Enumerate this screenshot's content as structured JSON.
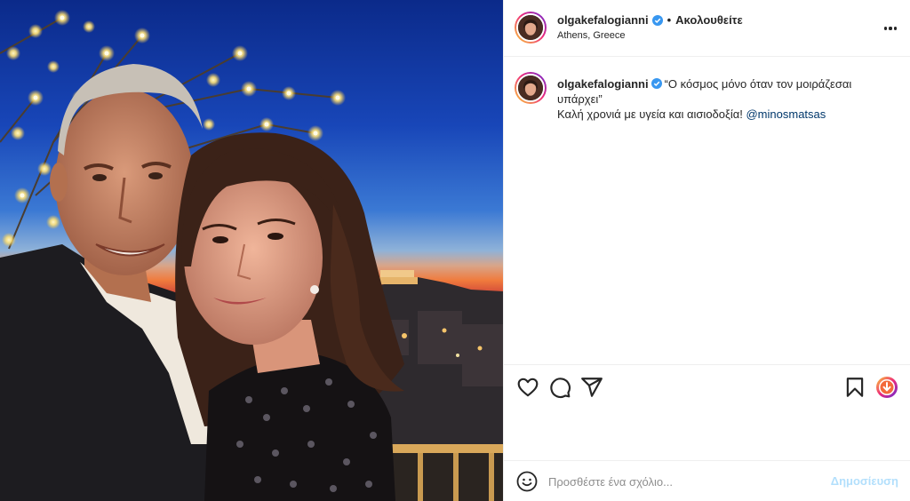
{
  "header": {
    "username": "olgakefalogianni",
    "separator": "•",
    "follow_label": "Ακολουθείτε",
    "location": "Athens, Greece",
    "more_icon": "more-horizontal-icon"
  },
  "caption": {
    "username": "olgakefalogianni",
    "quote": "“Ο κόσμος μόνο όταν τον μοιράζεσαι υπάρχει”",
    "line2": "Καλή χρονιά με υγεία και αισιοδοξία!",
    "mention": "@minosmatsas"
  },
  "actions": {
    "like_icon": "heart-icon",
    "comment_icon": "comment-icon",
    "share_icon": "send-icon",
    "save_icon": "bookmark-icon",
    "download_icon": "download-icon"
  },
  "comment_box": {
    "placeholder": "Προσθέστε ένα σχόλιο...",
    "post_label": "Δημοσίευση"
  },
  "colors": {
    "verified": "#3897f0",
    "mention": "#00376b",
    "post_disabled": "#b2dffc",
    "border": "#efefef"
  }
}
